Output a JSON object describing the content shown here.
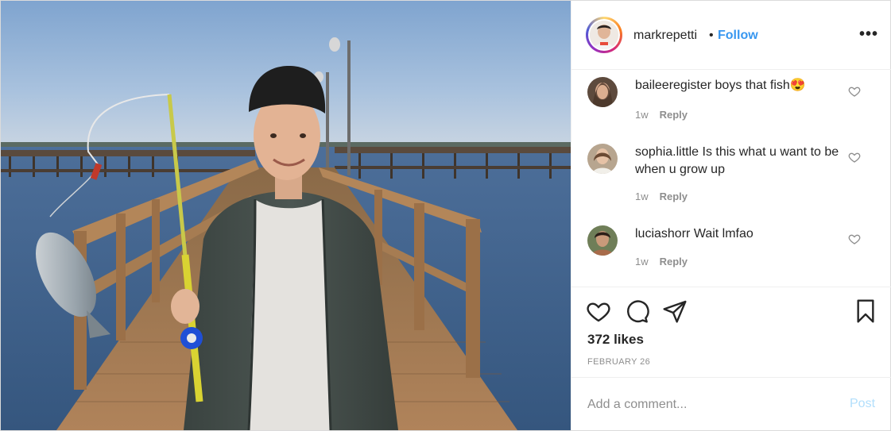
{
  "header": {
    "username": "markrepetti",
    "separator": "•",
    "follow_label": "Follow",
    "more_label": "•••"
  },
  "comments": [
    {
      "user": "baileeregister",
      "text": "boys that fish😍",
      "age": "1w",
      "reply_label": "Reply"
    },
    {
      "user": "sophia.little",
      "text": "Is this what u want to be when u grow up",
      "age": "1w",
      "reply_label": "Reply"
    },
    {
      "user": "luciashorr",
      "text": "Wait lmfao",
      "age": "1w",
      "reply_label": "Reply"
    }
  ],
  "actions": {
    "likes": "372 likes",
    "date": "FEBRUARY 26"
  },
  "add_comment": {
    "placeholder": "Add a comment...",
    "post_label": "Post"
  },
  "colors": {
    "follow": "#3897f0",
    "post_disabled": "#b2dffc",
    "muted_text": "#8e8e8e",
    "border": "#efefef"
  },
  "icons": [
    "more-options-icon",
    "heart-icon",
    "comment-icon",
    "share-icon",
    "bookmark-icon",
    "comment-like-heart-icon"
  ]
}
